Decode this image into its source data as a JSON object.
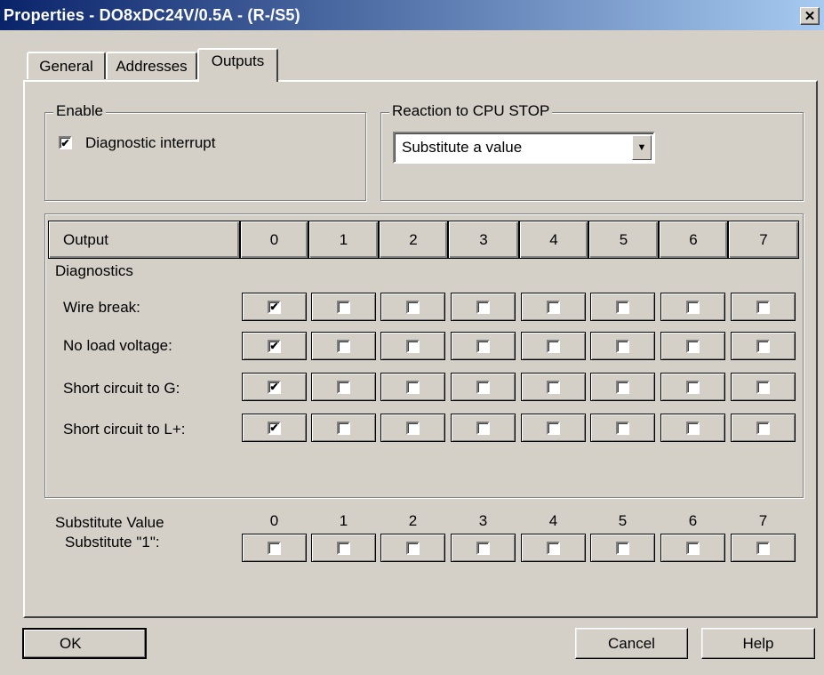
{
  "window": {
    "title": "Properties - DO8xDC24V/0.5A - (R-/S5)",
    "close_glyph": "✕"
  },
  "tabs": [
    {
      "label": "General"
    },
    {
      "label": "Addresses"
    },
    {
      "label": "Outputs"
    }
  ],
  "enable_group": {
    "label": "Enable",
    "diagnostic_interrupt": {
      "label": "Diagnostic interrupt",
      "checked": true
    }
  },
  "cpu_stop_group": {
    "label": "Reaction to CPU STOP",
    "selected": "Substitute a value",
    "arrow": "▼"
  },
  "table": {
    "output_header": "Output",
    "columns": [
      "0",
      "1",
      "2",
      "3",
      "4",
      "5",
      "6",
      "7"
    ],
    "diagnostics_label": "Diagnostics",
    "rows": [
      {
        "label": "Wire break:",
        "checked": [
          true,
          false,
          false,
          false,
          false,
          false,
          false,
          false
        ]
      },
      {
        "label": "No load voltage:",
        "checked": [
          true,
          false,
          false,
          false,
          false,
          false,
          false,
          false
        ]
      },
      {
        "label": "Short circuit to G:",
        "checked": [
          true,
          false,
          false,
          false,
          false,
          false,
          false,
          false
        ]
      },
      {
        "label": "Short circuit to L+:",
        "checked": [
          true,
          false,
          false,
          false,
          false,
          false,
          false,
          false
        ]
      }
    ]
  },
  "substitute": {
    "label": "Substitute Value",
    "columns": [
      "0",
      "1",
      "2",
      "3",
      "4",
      "5",
      "6",
      "7"
    ],
    "row_label": "Substitute \"1\":",
    "checked": [
      false,
      false,
      false,
      false,
      false,
      false,
      false,
      false
    ]
  },
  "buttons": {
    "ok": "OK",
    "cancel": "Cancel",
    "help": "Help"
  },
  "check_glyph": "✔"
}
